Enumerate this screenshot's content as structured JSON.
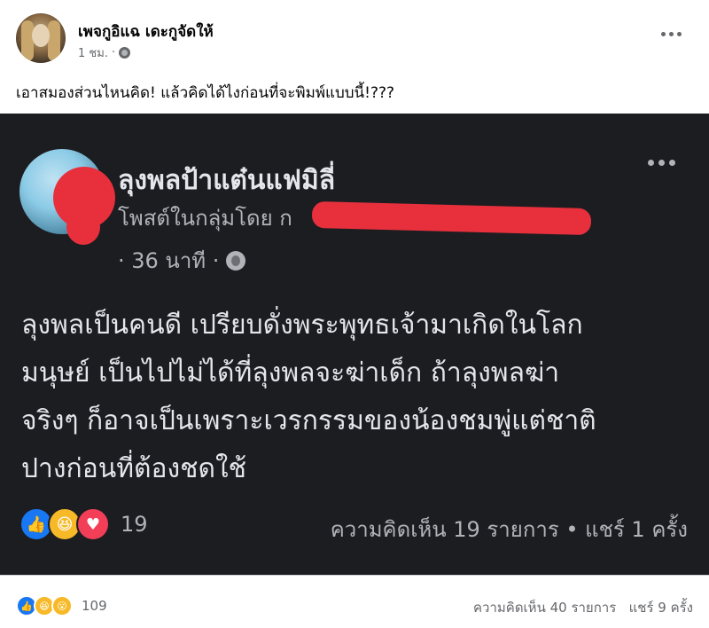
{
  "post": {
    "page_name": "เพจกูอิแฉ เดะกูจัดให้",
    "time": "1 ชม.",
    "separator": "·",
    "caption": "เอาสมองส่วนไหนคิด! แล้วคิดได้ไงก่อนที่จะพิมพ์แบบนี้!???",
    "reaction_icons": [
      "like-icon",
      "haha-icon",
      "wow-icon"
    ],
    "reaction_count": "109",
    "comments": "ความคิดเห็น 40 รายการ",
    "shares": "แชร์ 9 ครั้ง"
  },
  "screenshot": {
    "name": "ลุงพลป้าแต๋นแฟมิลี่",
    "group_line": "โพสต์ในกลุ่มโดย ก",
    "time": "· 36 นาที ·",
    "body_lines": [
      "ลุงพลเป็นคนดี เปรียบดั่งพระพุทธเจ้ามาเกิดในโลก",
      "มนุษย์ เป็นไปไม่ได้ที่ลุงพลจะฆ่าเด็ก ถ้าลุงพลฆ่า",
      "จริงๆ ก็อาจเป็นเพราะเวรกรรมของน้องชมพู่แต่ชาติ",
      "ปางก่อนที่ต้องชดใช้"
    ],
    "reaction_icons": [
      "like-icon",
      "haha-icon",
      "love-icon"
    ],
    "reaction_count": "19",
    "stats": "ความคิดเห็น 19 รายการ • แชร์ 1 ครั้ง"
  },
  "colors": {
    "dark_bg": "#1c1d21",
    "redaction": "#e8303d",
    "like_blue": "#1877f2",
    "love_red": "#f33e58",
    "haha_yellow": "#f7b928"
  }
}
